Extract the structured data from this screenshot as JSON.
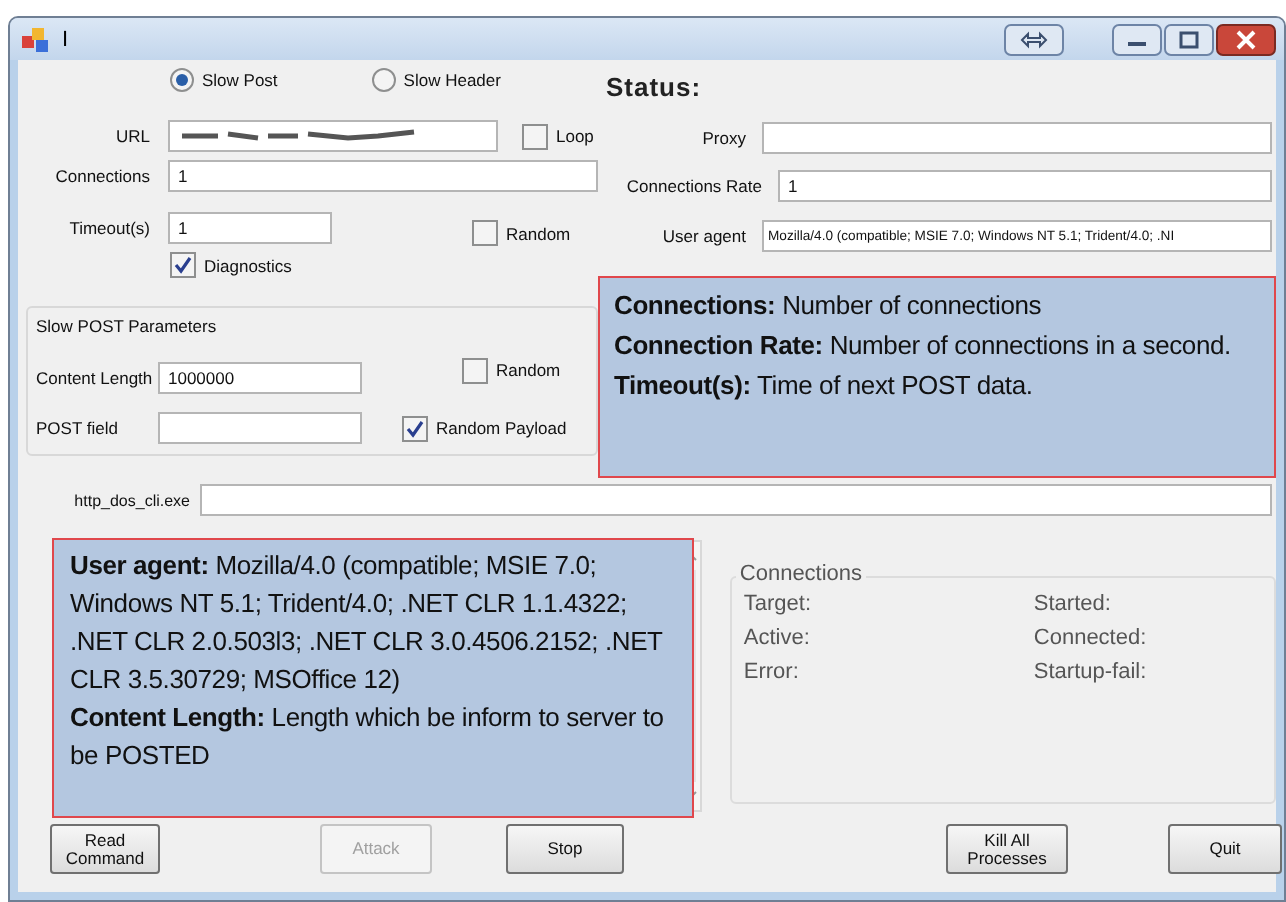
{
  "window": {
    "title": "I"
  },
  "attack_modes": [
    {
      "label": "Slow Post",
      "selected": true
    },
    {
      "label": "Slow Header",
      "selected": false
    }
  ],
  "url": {
    "label": "URL",
    "redacted": true
  },
  "loop": {
    "label": "Loop",
    "checked": false
  },
  "connections": {
    "label": "Connections",
    "value": "1"
  },
  "timeout": {
    "label": "Timeout(s)",
    "value": "1"
  },
  "timeout_random": {
    "label": "Random",
    "checked": false
  },
  "diagnostics": {
    "label": "Diagnostics",
    "checked": true
  },
  "slow_post_parameters": {
    "title": "Slow POST Parameters",
    "content_length": {
      "label": "Content Length",
      "value": "1000000"
    },
    "content_random": {
      "label": "Random",
      "checked": false
    },
    "post_field": {
      "label": "POST field"
    },
    "random_payload": {
      "label": "Random Payload",
      "checked": true
    }
  },
  "status": {
    "heading": "Status:"
  },
  "proxy": {
    "label": "Proxy"
  },
  "connections_rate": {
    "label": "Connections Rate",
    "value": "1"
  },
  "user_agent": {
    "label": "User agent",
    "value": "Mozilla/4.0 (compatible; MSIE 7.0; Windows NT 5.1; Trident/4.0; .NI"
  },
  "executable": {
    "label": "http_dos_cli.exe"
  },
  "connections_panel": {
    "title": "Connections",
    "items": [
      "Target:",
      "Started:",
      "Active:",
      "Connected:",
      "Error:",
      "Startup-fail:"
    ]
  },
  "annotations": [
    {
      "lines": [
        "**Connections:** Number of connections",
        "**Connection  Rate:** Number of connections in a second.",
        "**Timeout(s):** Time of next POST data."
      ]
    },
    {
      "lines": [
        "**User agent:** Mozilla/4.0 (compatible; MSIE 7.0; Windows NT 5.1; Trident/4.0; .NET CLR 1.1.4322; .NET CLR 2.0.503l3; .NET CLR 3.0.4506.2152; .NET CLR 3.5.30729; MSOffice 12)",
        "**Content Length:** Length which be inform to server to be POSTED"
      ]
    }
  ],
  "buttons": [
    {
      "label": "Read\nCommand",
      "disabled": false
    },
    {
      "label": "Attack",
      "disabled": true
    },
    {
      "label": "Stop",
      "disabled": false
    },
    {
      "label": "Kill All\nProcesses",
      "disabled": false
    },
    {
      "label": "Quit",
      "disabled": false
    }
  ]
}
